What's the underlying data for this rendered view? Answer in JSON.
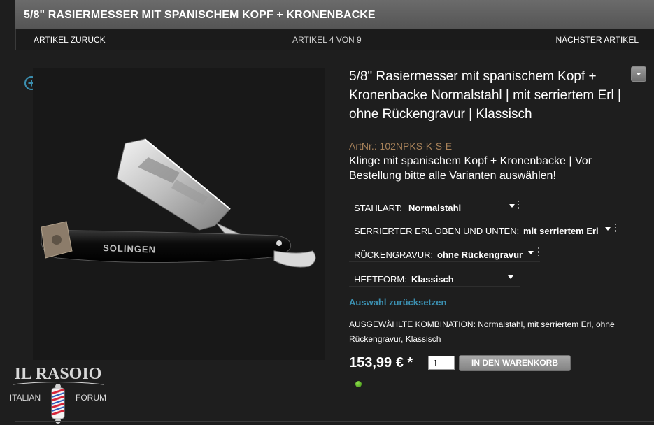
{
  "header": {
    "title": "5/8\" RASIERMESSER MIT SPANISCHEM KOPF + KRONENBACKE"
  },
  "nav": {
    "prev_label": "ARTIKEL ZURÜCK",
    "counter": "ARTIKEL 4 VON 9",
    "next_label": "NÄCHSTER ARTIKEL"
  },
  "product": {
    "title": "5/8\" Rasiermesser mit spanischem Kopf + Kronenbacke Normalstahl | mit serriertem Erl | ohne Rückengravur | Klassisch",
    "artnr": "ArtNr.: 102NPKS-K-S-E",
    "description": "Klinge mit spanischem Kopf + Kronenbacke | Vor Bestellung bitte alle Varianten auswählen!",
    "image_engraving": "SOLINGEN"
  },
  "variants": [
    {
      "label": "STAHLART:",
      "value": "Normalstahl"
    },
    {
      "label": "SERRIERTER ERL OBEN UND UNTEN:",
      "value": "mit serriertem Erl"
    },
    {
      "label": "RÜCKENGRAVUR:",
      "value": "ohne Rückengravur"
    },
    {
      "label": "HEFTFORM:",
      "value": "Klassisch"
    }
  ],
  "reset_label": "Auswahl zurücksetzen",
  "combination": {
    "label": "AUSGEWÄHLTE KOMBINATION:",
    "value": "Normalstahl, mit serriertem Erl, ohne Rückengravur, Klassisch"
  },
  "purchase": {
    "price": "153,99 € *",
    "quantity": "1",
    "cart_label": "IN DEN WARENKORB"
  },
  "logo": {
    "line1": "IL RASOIO",
    "line2": "ITALIAN",
    "line3": "FORUM"
  },
  "icons": {
    "zoom": "zoom-plus-icon",
    "toggle": "chevron-down-icon",
    "dropdown": "dropdown-arrow-icon",
    "stock": "stock-status-icon",
    "barber_pole": "barber-pole-icon"
  },
  "colors": {
    "background": "#1e1e1e",
    "header": "#5f5f5f",
    "artnr": "#a8825a",
    "link": "#3b8fb0",
    "stock_green": "#5bbf2a"
  }
}
